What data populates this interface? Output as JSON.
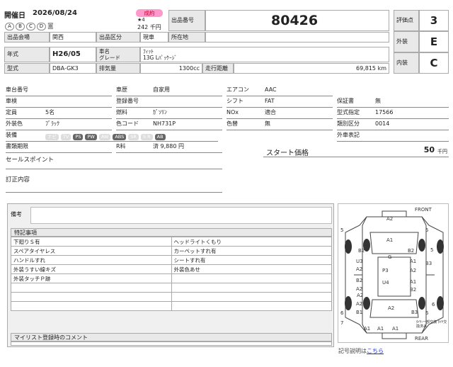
{
  "header": {
    "date_label": "開催日",
    "date_value": "2026/08/24",
    "circles": [
      "A",
      "B",
      "C",
      "D"
    ],
    "sold_badge": "成約",
    "stars": "★4",
    "price": "242 千円",
    "lot_label": "出品番号",
    "lot_value": "80426",
    "hall_label": "出品会場",
    "hall_value": "関西",
    "category_label": "出品区分",
    "category_value": "現車",
    "location_label": "所在地",
    "location_value": ""
  },
  "grades": [
    {
      "label": "評価点",
      "value": "3"
    },
    {
      "label": "外装",
      "value": "E"
    },
    {
      "label": "内装",
      "value": "C"
    }
  ],
  "vehicle": {
    "year_label": "年式",
    "year_value": "H26/05",
    "name_label": "車名",
    "grade_label": "グレード",
    "name_value": "ﾌｨｯﾄ",
    "grade_value": "13G Lﾊﾟｯｹｰｼﾞ",
    "model_label": "型式",
    "model_value": "DBA-GK3",
    "displacement_label": "排気量",
    "displacement_value": "1300cc",
    "mileage_label": "走行距離",
    "mileage_value": "69,815 km"
  },
  "details_col1": [
    {
      "label": "車台番号",
      "value": ""
    },
    {
      "label": "車検",
      "value": ""
    },
    {
      "label": "定員",
      "value": "5名"
    },
    {
      "label": "外装色",
      "value": "ﾌﾞﾗｯｸ"
    },
    {
      "label": "装備",
      "value": ""
    },
    {
      "label": "書類期限",
      "value": ""
    }
  ],
  "equipment": [
    {
      "label": "ナビ",
      "on": false
    },
    {
      "label": "TV",
      "on": false
    },
    {
      "label": "PS",
      "on": true
    },
    {
      "label": "PW",
      "on": true
    },
    {
      "label": "AW",
      "on": false
    },
    {
      "label": "ABS",
      "on": true
    },
    {
      "label": "SR",
      "on": false
    },
    {
      "label": "S R",
      "on": false
    },
    {
      "label": "AB",
      "on": true
    }
  ],
  "details_col2": [
    {
      "label": "車歴",
      "value": "自家用"
    },
    {
      "label": "登録番号",
      "value": ""
    },
    {
      "label": "燃料",
      "value": "ｶﾞｿﾘﾝ"
    },
    {
      "label": "色コード",
      "value": "NH731P"
    },
    {
      "label": "R料",
      "value": "済 9,880 円"
    }
  ],
  "details_col3": [
    {
      "label": "エアコン",
      "value": "AAC"
    },
    {
      "label": "シフト",
      "value": "FAT"
    },
    {
      "label": "NOx",
      "value": "適合"
    },
    {
      "label": "色替",
      "value": "無"
    }
  ],
  "details_col4": [
    {
      "label": "保証書",
      "value": "無"
    },
    {
      "label": "型式指定",
      "value": "17566"
    },
    {
      "label": "類別区分",
      "value": "0014"
    },
    {
      "label": "外車表記",
      "value": ""
    }
  ],
  "start_price": {
    "label": "スタート価格",
    "value": "50",
    "unit": "千円"
  },
  "sales_point_label": "セールスポイント",
  "correction_label": "訂正内容",
  "remarks_label": "備考",
  "notes": {
    "title": "特記事項",
    "rows": [
      [
        "下廻りＳ有",
        "ヘッドライトくもり"
      ],
      [
        "スペアタイヤレス",
        "カーペットすれ有"
      ],
      [
        "ハンドルすれ",
        "シートすれ有"
      ],
      [
        "外装うすい線キズ",
        "外装色あせ"
      ],
      [
        "外装タッチＰ跡",
        ""
      ],
      [
        "",
        ""
      ],
      [
        "",
        ""
      ],
      [
        "",
        ""
      ]
    ]
  },
  "mylist_label": "マイリスト登録時のコメント",
  "diagram": {
    "front": "FRONT",
    "rear": "REAR",
    "legend_text": "記号説明は",
    "legend_link": "こちら",
    "tire_note": "ﾀｲﾔ:一部交換 ﾀｲﾔ交換済み",
    "marks": [
      "A2",
      "A1",
      "G",
      "B2",
      "B2",
      "U3",
      "A2",
      "P3",
      "A1",
      "B3",
      "A2",
      "A1",
      "U4",
      "B2",
      "B2",
      "A2",
      "B3",
      "B1",
      "A2",
      "A2",
      "A1",
      "A1",
      "A1",
      "5",
      "5",
      "5",
      "6",
      "6",
      "6",
      "7",
      "A2"
    ]
  }
}
